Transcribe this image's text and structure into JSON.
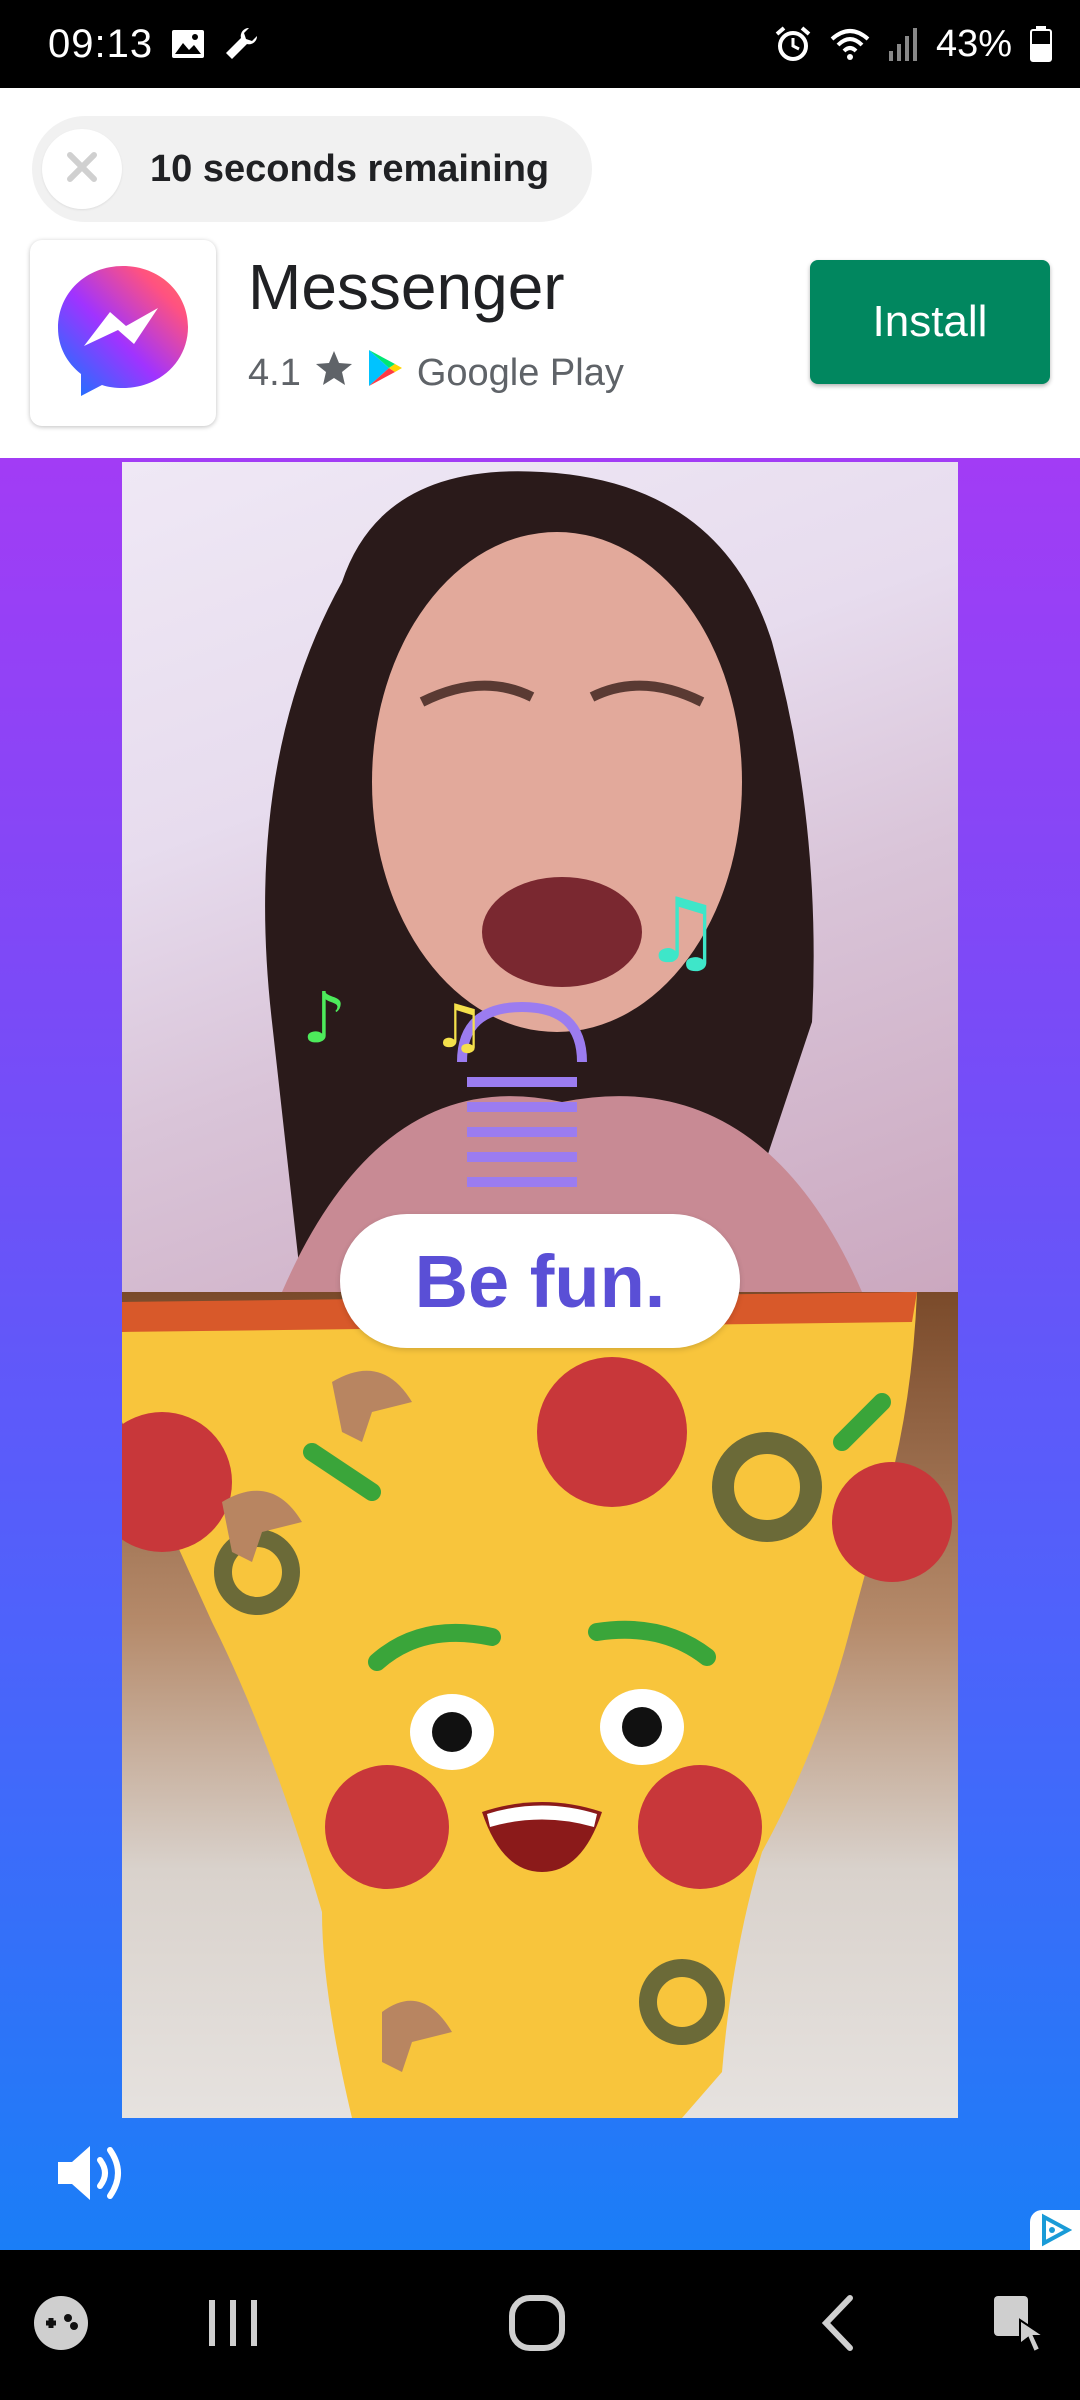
{
  "status_bar": {
    "time": "09:13",
    "battery": "43%"
  },
  "ad": {
    "timer_text": "10 seconds remaining",
    "app_name": "Messenger",
    "rating": "4.1",
    "store_name": "Google Play",
    "install_label": "Install",
    "caption": "Be fun."
  },
  "colors": {
    "install_green": "#01875f",
    "gradient_top": "#a23cf5",
    "gradient_bottom": "#1a7ef7"
  },
  "icons": {
    "status_left": [
      "image-icon",
      "wrench-icon"
    ],
    "status_right": [
      "alarm-icon",
      "wifi-icon",
      "signal-icon",
      "battery-icon"
    ],
    "nav": [
      "game-launcher-icon",
      "recents-icon",
      "home-icon",
      "back-icon",
      "accessibility-icon"
    ]
  }
}
